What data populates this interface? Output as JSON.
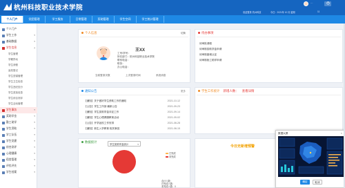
{
  "header": {
    "school_name": "杭州科技职业技术学院",
    "info_left": "欢迎登录 杭州科技",
    "info_mid": "今日：2021年 10 月 星期",
    "info_right": "11",
    "user_text": "…",
    "logout_label": "…"
  },
  "nav": {
    "tabs": [
      {
        "label": "个人门户"
      },
      {
        "label": "党团管理"
      },
      {
        "label": "学工服务"
      },
      {
        "label": "日常管理"
      },
      {
        "label": "奖助管理"
      },
      {
        "label": "学生空间"
      },
      {
        "label": "学工统计管理"
      }
    ]
  },
  "sidebar": {
    "items": [
      {
        "label": "个人门户"
      },
      {
        "label": "学生工作"
      },
      {
        "label": "基础数据"
      },
      {
        "label": "学生信息"
      },
      {
        "label": "学生事务"
      },
      {
        "label": "奖助学金"
      },
      {
        "label": "勤工助学"
      },
      {
        "label": "学生资助"
      },
      {
        "label": "学工队伍"
      },
      {
        "label": "学生党建"
      },
      {
        "label": "综合测评"
      },
      {
        "label": "心理健康"
      },
      {
        "label": "宿舍管理"
      },
      {
        "label": "评优评先"
      },
      {
        "label": "学生档案"
      }
    ],
    "subitems": [
      {
        "label": "学生管理"
      },
      {
        "label": "学籍异动"
      },
      {
        "label": "学生请假"
      },
      {
        "label": "返校登记"
      },
      {
        "label": "学生查寝管理"
      },
      {
        "label": "学生卫生检查"
      },
      {
        "label": "学生违纪处分"
      },
      {
        "label": "学生奖惩信息"
      },
      {
        "label": "学生综合测评"
      },
      {
        "label": "学生活动管理"
      }
    ]
  },
  "profile": {
    "title": "个人信息",
    "switch_label": "切换",
    "name": "王XX",
    "lines": [
      "工号/学号：",
      "所在部门：杭州科技职业技术学院",
      "联系电话：",
      "职务：",
      "办公电话："
    ],
    "stats": [
      "当前登录次数",
      "上次登录时间",
      "系统消息"
    ]
  },
  "todo": {
    "title": "待办事项",
    "items": [
      {
        "text": "待审批请假"
      },
      {
        "text": "待审核奖助学金申请"
      },
      {
        "text": "待审核困难认定"
      },
      {
        "text": "待审核勤工助学申请"
      }
    ]
  },
  "notice": {
    "title": "通知公告",
    "more_label": "更多",
    "items": [
      {
        "text": "【通知】关于做好学生资助工作的通知",
        "date": "2021-10-12"
      },
      {
        "text": "【公告】学生工作部 最新公告",
        "date": "2021-09-23"
      },
      {
        "text": "【通知】学生奖助学金评定工作",
        "date": "2021-09-14"
      },
      {
        "text": "【通知】学生心理健康教育活动",
        "date": "2021-09-02"
      },
      {
        "text": "【公告】开学返校工作安排",
        "date": "2021-08-28"
      },
      {
        "text": "【通知】新生入学教育 相关事宜",
        "date": "2021-08-15"
      }
    ]
  },
  "stats_chart": {
    "title": "数据统计",
    "select_value": "学生奖助学金统计",
    "legend": [
      {
        "name": "已完成",
        "color": "#ffb74d"
      },
      {
        "name": "未完成",
        "color": "#e53935"
      }
    ],
    "footer_lines": [
      "合计人数：",
      "已完成人数：",
      "未完成人数：0"
    ],
    "colors": {
      "pie": "#e53935"
    }
  },
  "middle_right": {
    "title": "学生工作统计",
    "link1": "新增人数：",
    "link2": "查看详情"
  },
  "banner": {
    "text": "今日无新增预警"
  },
  "dialog": {
    "title": "数据大屏",
    "close_icon": "close-icon",
    "ok_label": "确定",
    "cancel_label": "取消"
  }
}
